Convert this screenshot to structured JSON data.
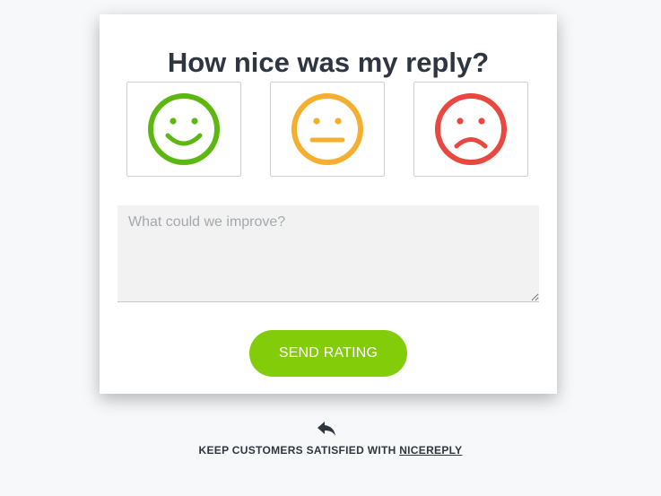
{
  "card": {
    "title": "How nice was my reply?",
    "ratings": [
      {
        "name": "happy",
        "color": "#5cb811"
      },
      {
        "name": "neutral",
        "color": "#f5ae2d"
      },
      {
        "name": "sad",
        "color": "#e8483f"
      }
    ],
    "feedback_placeholder": "What could we improve?",
    "send_label": "SEND RATING"
  },
  "colors": {
    "accent": "#82cc0a",
    "text": "#2f3640",
    "background": "#f7f8fa"
  },
  "footer": {
    "icon": "reply-icon",
    "text": "KEEP CUSTOMERS SATISFIED WITH ",
    "link": "NICEREPLY"
  }
}
